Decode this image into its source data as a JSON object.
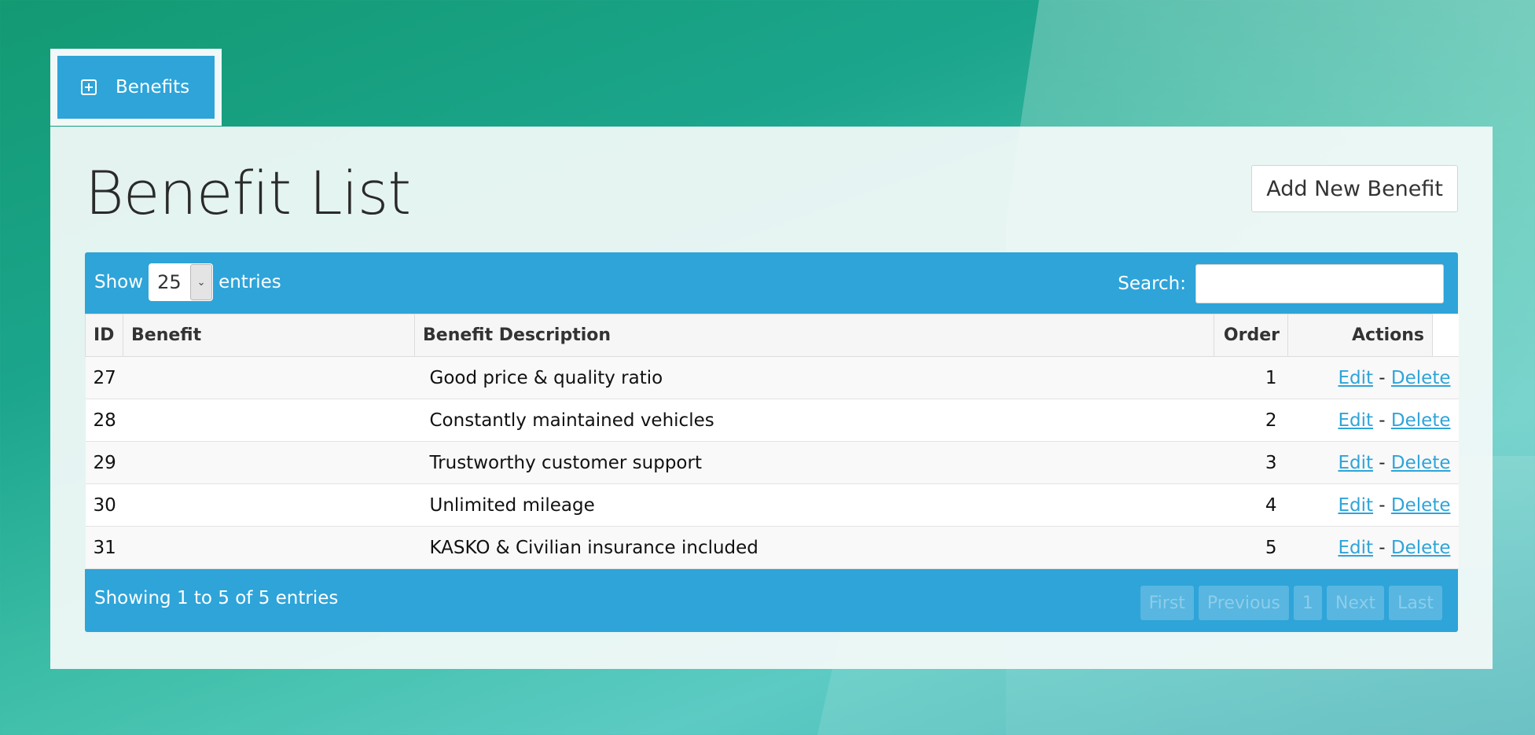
{
  "tab": {
    "label": "Benefits"
  },
  "page": {
    "title": "Benefit List",
    "add_button": "Add New Benefit"
  },
  "controls": {
    "show_label": "Show",
    "entries_label": "entries",
    "page_length": "25",
    "search_label": "Search:",
    "search_value": ""
  },
  "table": {
    "headers": [
      "ID",
      "Benefit",
      "Benefit Description",
      "Order",
      "Actions"
    ],
    "rows": [
      {
        "id": "27",
        "benefit": "",
        "description": "Good price & quality ratio",
        "order": "1"
      },
      {
        "id": "28",
        "benefit": "",
        "description": "Constantly maintained vehicles",
        "order": "2"
      },
      {
        "id": "29",
        "benefit": "",
        "description": "Trustworthy customer support",
        "order": "3"
      },
      {
        "id": "30",
        "benefit": "",
        "description": "Unlimited mileage",
        "order": "4"
      },
      {
        "id": "31",
        "benefit": "",
        "description": "KASKO & Civilian insurance included",
        "order": "5"
      }
    ],
    "edit_label": "Edit",
    "separator": " - ",
    "delete_label": "Delete"
  },
  "footer": {
    "info": "Showing 1 to 5 of 5 entries",
    "pagination": {
      "first": "First",
      "previous": "Previous",
      "page": "1",
      "next": "Next",
      "last": "Last"
    }
  },
  "colors": {
    "accent": "#2ea4d9",
    "link": "#2ea4d9"
  },
  "icons": {
    "tab_icon": "plus-square-icon",
    "select_arrow": "chevron-down-icon"
  }
}
